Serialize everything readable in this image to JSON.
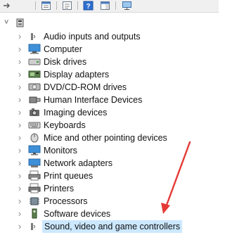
{
  "toolbar": {
    "buttons": [
      "back-icon",
      "forward-icon",
      "properties-icon",
      "update-driver-icon",
      "help-icon",
      "action-pane-icon",
      "scan-hardware-icon"
    ]
  },
  "tree": {
    "root_expand": "˅",
    "items": [
      {
        "label": "Audio inputs and outputs",
        "icon": "audio-icon"
      },
      {
        "label": "Computer",
        "icon": "computer-icon"
      },
      {
        "label": "Disk drives",
        "icon": "disk-drive-icon"
      },
      {
        "label": "Display adapters",
        "icon": "display-adapter-icon"
      },
      {
        "label": "DVD/CD-ROM drives",
        "icon": "dvd-drive-icon"
      },
      {
        "label": "Human Interface Devices",
        "icon": "hid-icon"
      },
      {
        "label": "Imaging devices",
        "icon": "camera-icon"
      },
      {
        "label": "Keyboards",
        "icon": "keyboard-icon"
      },
      {
        "label": "Mice and other pointing devices",
        "icon": "mouse-icon"
      },
      {
        "label": "Monitors",
        "icon": "monitor-icon"
      },
      {
        "label": "Network adapters",
        "icon": "network-adapter-icon"
      },
      {
        "label": "Print queues",
        "icon": "print-queue-icon"
      },
      {
        "label": "Printers",
        "icon": "printer-icon"
      },
      {
        "label": "Processors",
        "icon": "processor-icon"
      },
      {
        "label": "Software devices",
        "icon": "software-device-icon"
      },
      {
        "label": "Sound, video and game controllers",
        "icon": "sound-controller-icon"
      }
    ],
    "expand_glyph": "›"
  },
  "annotation": {
    "color": "#e53935"
  }
}
